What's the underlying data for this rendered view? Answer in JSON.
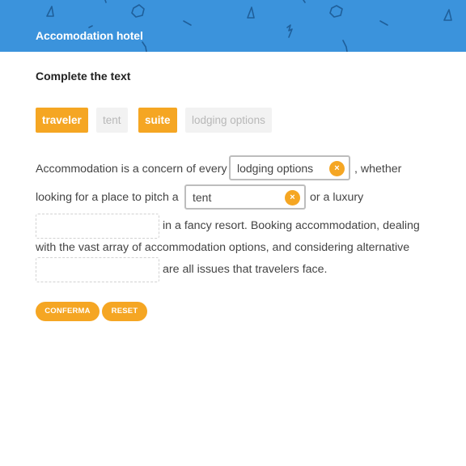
{
  "header": {
    "title": "Accomodation hotel",
    "background_color": "#3b93dc"
  },
  "exercise": {
    "title": "Complete the text",
    "word_bank": [
      {
        "label": "traveler",
        "state": "available"
      },
      {
        "label": "tent",
        "state": "used"
      },
      {
        "label": "suite",
        "state": "available"
      },
      {
        "label": "lodging options",
        "state": "used"
      }
    ],
    "text": {
      "line1_before": "Accommodation is a concern of every",
      "line1_after": ", whether",
      "line2_before": "looking for a place to pitch a",
      "line2_after": "or a luxury",
      "line3_after": "in a fancy resort. Booking accommodation, dealing",
      "line4": "with the vast array of accommodation options, and considering alternative",
      "line5_after": "are all issues that travelers face."
    },
    "blanks": [
      {
        "value": "lodging options",
        "clear_icon": "close-icon"
      },
      {
        "value": "tent",
        "clear_icon": "close-icon"
      },
      {
        "value": ""
      },
      {
        "value": ""
      }
    ]
  },
  "actions": {
    "confirm_label": "CONFERMA",
    "reset_label": "RESET"
  },
  "colors": {
    "accent": "#f5a623",
    "chip_used_bg": "#f2f2f2",
    "chip_used_text": "#b8b8b8"
  }
}
